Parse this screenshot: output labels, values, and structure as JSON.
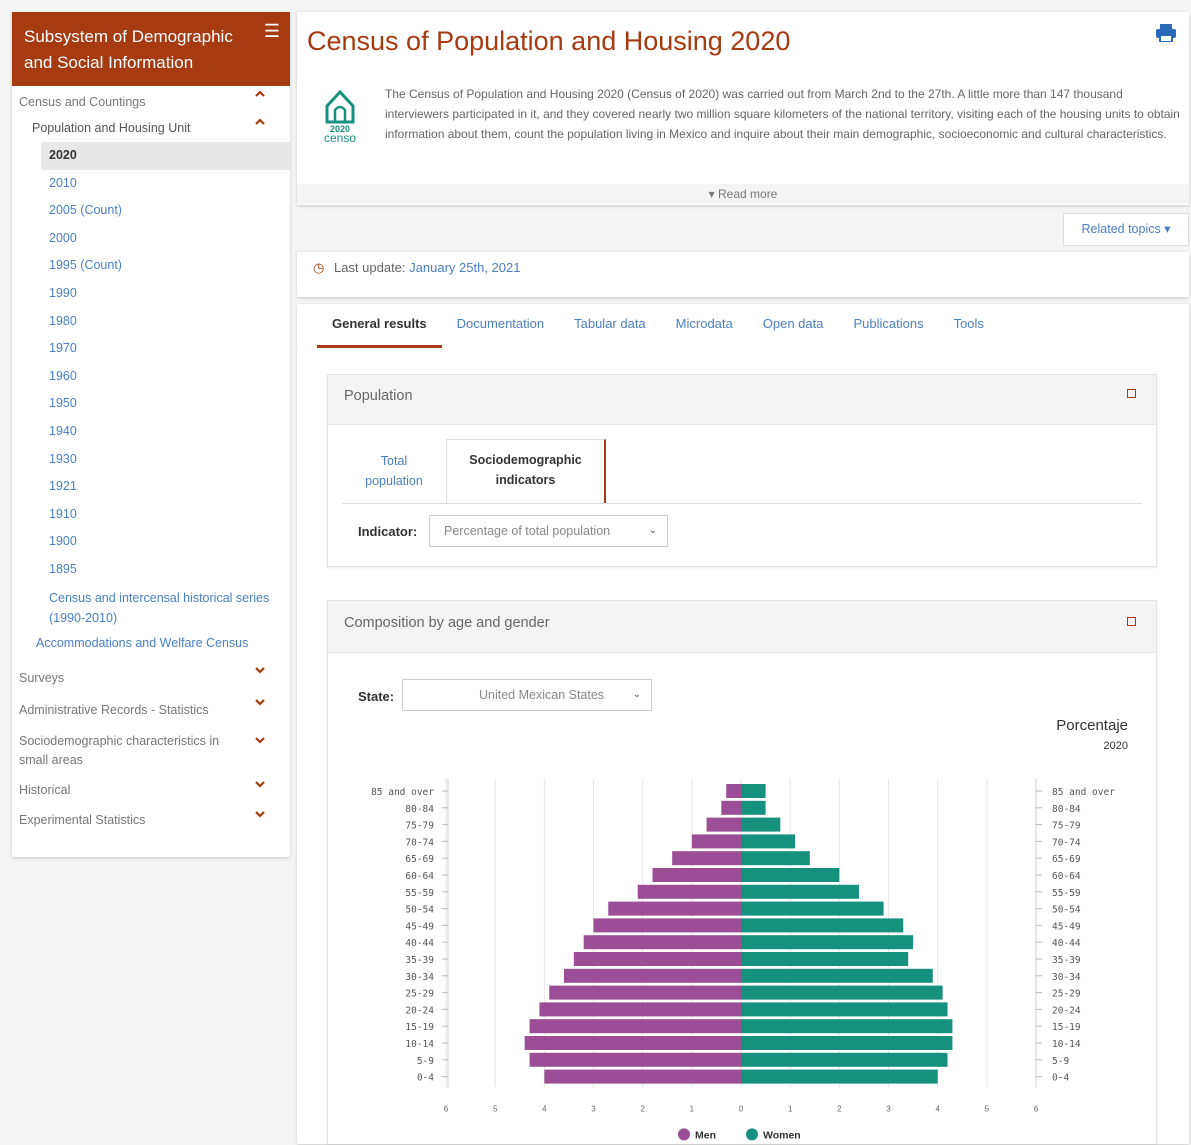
{
  "sidebar": {
    "title": "Subsystem of Demographic and Social Information",
    "items": [
      {
        "label": "Census and Countings"
      },
      {
        "label": "Population and Housing Unit"
      }
    ],
    "years": [
      "2020",
      "2010",
      "2005 (Count)",
      "2000",
      "1995 (Count)",
      "1990",
      "1980",
      "1970",
      "1960",
      "1950",
      "1940",
      "1930",
      "1921",
      "1910",
      "1900",
      "1895"
    ],
    "historic": "Census and intercensal historical series (1990-2010)",
    "accommodations": "Accommodations and Welfare Census",
    "sections": [
      "Surveys",
      "Administrative Records - Statistics",
      "Sociodemographic characteristics in small areas",
      "Historical",
      "Experimental Statistics"
    ]
  },
  "header": {
    "title": "Census of Population and Housing 2020",
    "intro": "The Census of Population and Housing 2020 (Census of 2020) was carried out from March 2nd to the 27th. A little more than 147 thousand interviewers participated in it, and they covered nearly two million square kilometers of the national territory, visiting each of the housing units to obtain information about them, count the population living in Mexico and inquire about their main demographic, socioeconomic and cultural characteristics.",
    "read_more": "▾ Read more",
    "logo_year": "2020",
    "logo_word": "censo"
  },
  "related_topics": "Related topics ▾",
  "last_update": {
    "label": "Last update:",
    "date": "January 25th, 2021"
  },
  "tabs": [
    "General results",
    "Documentation",
    "Tabular data",
    "Microdata",
    "Open data",
    "Publications",
    "Tools"
  ],
  "population_panel": {
    "title": "Population",
    "subtabs": [
      "Total population",
      "Sociodemographic indicators"
    ],
    "indicator_label": "Indicator:",
    "indicator_value": "Percentage of total population"
  },
  "composition_panel": {
    "title": "Composition by age and gender",
    "state_label": "State:",
    "state_value": "United Mexican States"
  },
  "chart_data": {
    "type": "bar",
    "title": "Porcentaje",
    "subtitle": "2020",
    "categories": [
      "85 and over",
      "80-84",
      "75-79",
      "70-74",
      "65-69",
      "60-64",
      "55-59",
      "50-54",
      "45-49",
      "40-44",
      "35-39",
      "30-34",
      "25-29",
      "20-24",
      "15-19",
      "10-14",
      "5-9",
      "0-4"
    ],
    "series": [
      {
        "name": "Men",
        "color": "#9b4d96",
        "values": [
          0.3,
          0.4,
          0.7,
          1.0,
          1.4,
          1.8,
          2.1,
          2.7,
          3.0,
          3.2,
          3.4,
          3.6,
          3.9,
          4.1,
          4.3,
          4.4,
          4.3,
          4.0
        ]
      },
      {
        "name": "Women",
        "color": "#15917d",
        "values": [
          0.5,
          0.5,
          0.8,
          1.1,
          1.4,
          2.0,
          2.4,
          2.9,
          3.3,
          3.5,
          3.4,
          3.9,
          4.1,
          4.2,
          4.3,
          4.3,
          4.2,
          4.0
        ]
      }
    ],
    "xlim": [
      -6,
      6
    ],
    "legend": "bottom",
    "grid": true
  }
}
